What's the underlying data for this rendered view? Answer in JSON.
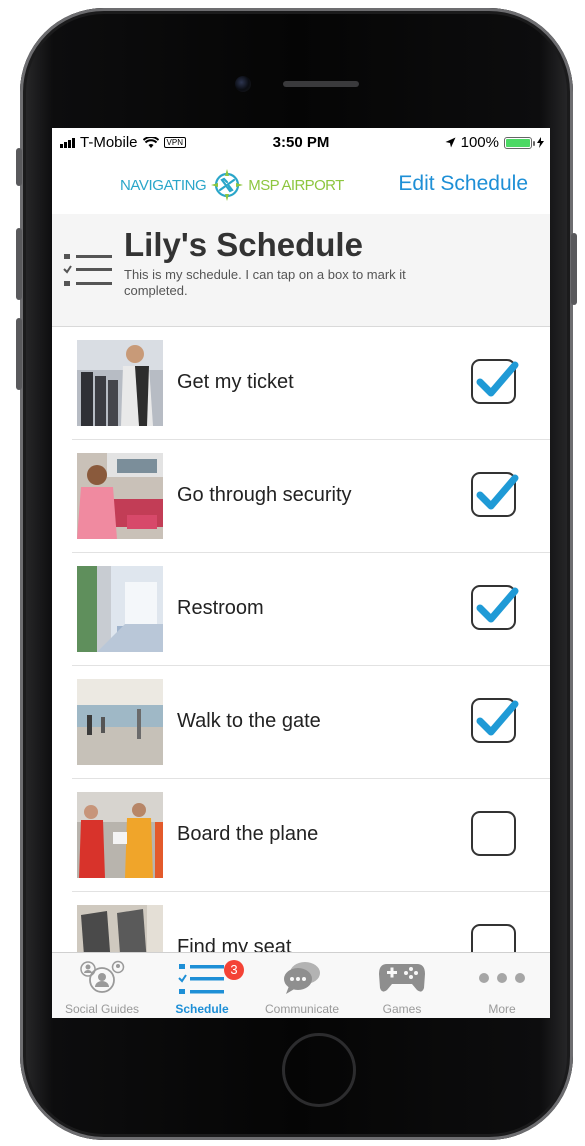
{
  "status_bar": {
    "carrier": "T-Mobile",
    "vpn": "VPN",
    "time": "3:50 PM",
    "battery": "100%"
  },
  "nav": {
    "logo_part1": "NAVIGATING",
    "logo_part2": "MSP AIRPORT",
    "edit_label": "Edit Schedule"
  },
  "header": {
    "title": "Lily's Schedule",
    "subtitle": "This is my schedule. I can tap on a box to mark it completed."
  },
  "schedule": [
    {
      "label": "Get my ticket",
      "completed": true,
      "photo": "ticket-kiosk-photo"
    },
    {
      "label": "Go through security",
      "completed": true,
      "photo": "security-photo"
    },
    {
      "label": "Restroom",
      "completed": true,
      "photo": "restroom-photo"
    },
    {
      "label": "Walk to the gate",
      "completed": true,
      "photo": "terminal-photo"
    },
    {
      "label": "Board the plane",
      "completed": false,
      "photo": "boarding-photo"
    },
    {
      "label": "Find my seat",
      "completed": false,
      "photo": "cabin-seat-photo"
    }
  ],
  "tabs": [
    {
      "label": "Social Guides",
      "icon": "social-guides-icon",
      "active": false
    },
    {
      "label": "Schedule",
      "icon": "schedule-list-icon",
      "active": true,
      "badge": "3"
    },
    {
      "label": "Communicate",
      "icon": "chat-bubbles-icon",
      "active": false
    },
    {
      "label": "Games",
      "icon": "gamepad-icon",
      "active": false
    },
    {
      "label": "More",
      "icon": "more-dots-icon",
      "active": false
    }
  ],
  "colors": {
    "accent": "#1e8fd6",
    "check": "#1f9ad6",
    "logo_blue": "#2aa6c9",
    "logo_green": "#8dc63f",
    "badge": "#f44336"
  }
}
